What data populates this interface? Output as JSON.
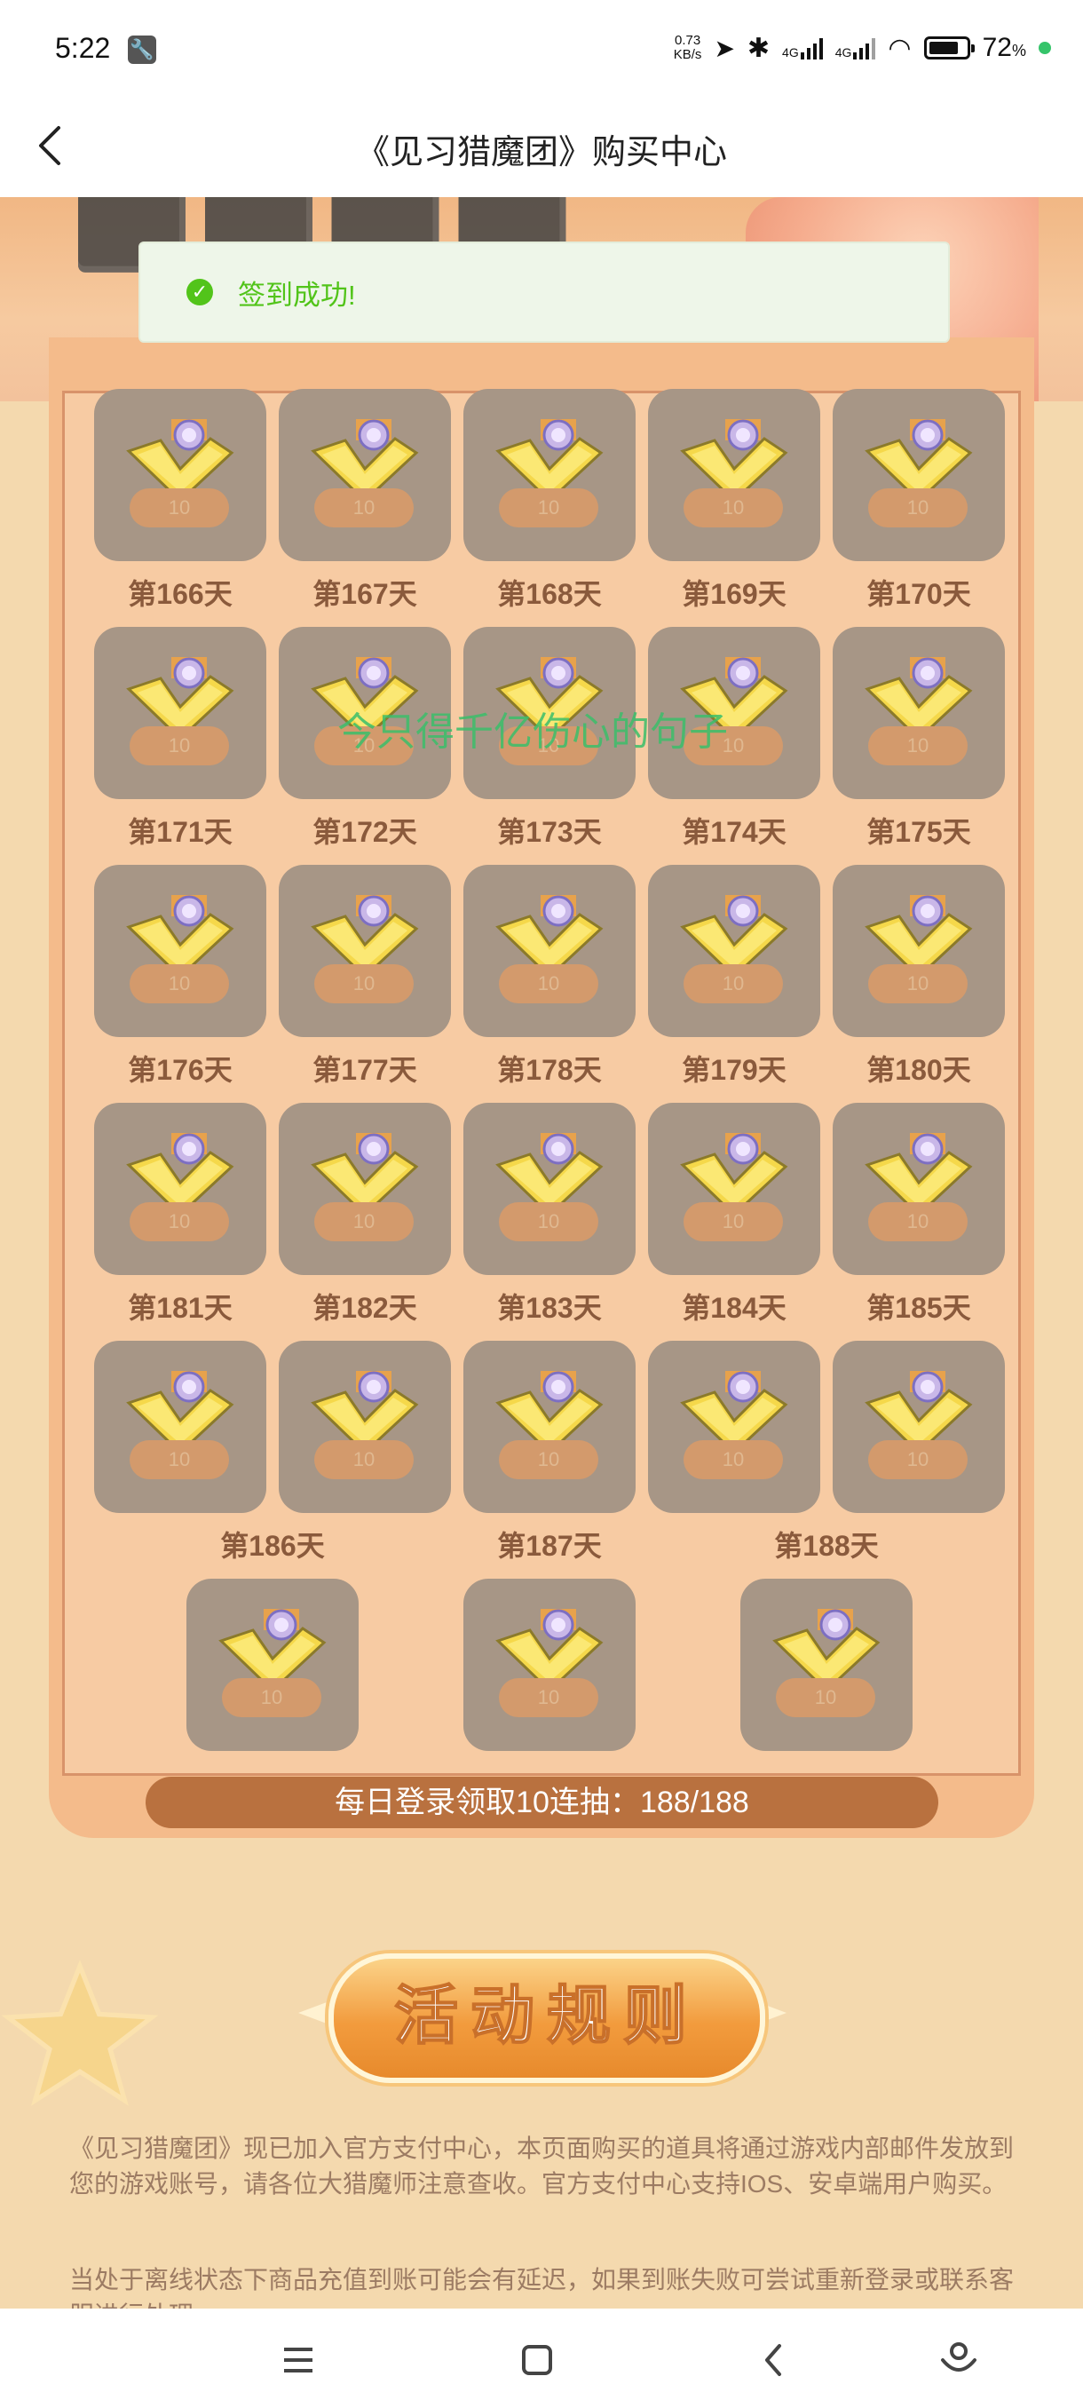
{
  "status_bar": {
    "time": "5:22",
    "speed_value": "0.73",
    "speed_unit": "KB/s",
    "network_1": "4G",
    "network_2": "4G",
    "battery": "72"
  },
  "header": {
    "title": "《见习猎魔团》购买中心"
  },
  "toast": {
    "message": "签到成功!"
  },
  "watermark": "今只得千亿伤心的句子",
  "rewards": {
    "tile_amount": "10",
    "rows": [
      [
        "第166天",
        "第167天",
        "第168天",
        "第169天",
        "第170天"
      ],
      [
        "第171天",
        "第172天",
        "第173天",
        "第174天",
        "第175天"
      ],
      [
        "第176天",
        "第177天",
        "第178天",
        "第179天",
        "第180天"
      ],
      [
        "第181天",
        "第182天",
        "第183天",
        "第184天",
        "第185天"
      ],
      [
        "第186天",
        "第187天",
        "第188天"
      ]
    ]
  },
  "progress": {
    "label": "每日登录领取10连抽：188/188",
    "current": 188,
    "total": 188
  },
  "rules": {
    "button_label": "活动规则",
    "paragraph_1": "《见习猎魔团》现已加入官方支付中心，本页面购买的道具将通过游戏内部邮件发放到您的游戏账号，请各位大猎魔师注意查收。官方支付中心支持IOS、安卓端用户购买。",
    "paragraph_2": "当处于离线状态下商品充值到账可能会有延迟，如果到账失败可尝试重新登录或联系客服进行处理。"
  },
  "nav": {
    "icons": [
      "menu-icon",
      "home-square-icon",
      "back-triangle-icon",
      "assistant-icon"
    ]
  },
  "colors": {
    "tile": "#a79686",
    "day_label": "#8a5a3c",
    "progress_bar": "#b9713f",
    "success": "#52c41a"
  }
}
